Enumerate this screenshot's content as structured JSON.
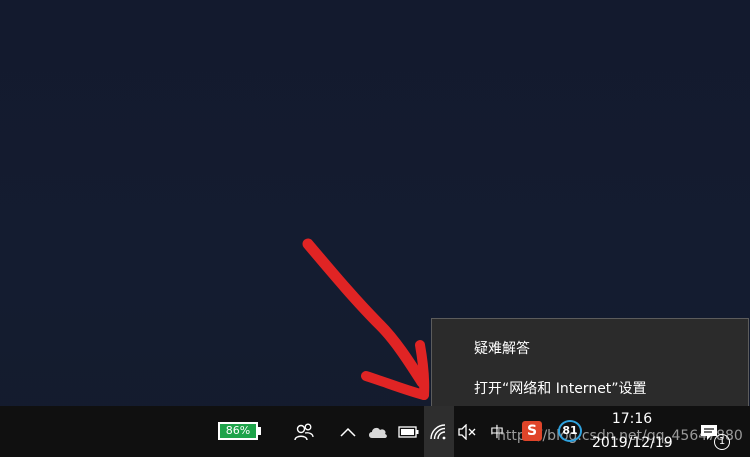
{
  "context_menu": {
    "items": [
      {
        "label": "疑难解答"
      },
      {
        "label": "打开“网络和 Internet”设置"
      }
    ]
  },
  "taskbar": {
    "battery_percent_label": "86%",
    "ime_label": "中",
    "sogou_label": "S",
    "badge_label": "81",
    "time": "17:16",
    "date": "2019/12/19",
    "notification_count": "1"
  },
  "watermark": "https://blog.csdn.net/qq_45647880",
  "icons": {
    "people": "people-icon",
    "chevron": "chevron-up-icon",
    "cloud": "onedrive-cloud-icon",
    "battery": "battery-icon",
    "wifi": "wifi-icon",
    "volume": "volume-muted-icon",
    "notification": "action-center-icon"
  },
  "colors": {
    "desktop": "#141b2f",
    "taskbar": "#101010",
    "menu_bg": "#2b2b2b",
    "battery_fill": "#1ea34a",
    "annotation_arrow": "#e02424"
  }
}
